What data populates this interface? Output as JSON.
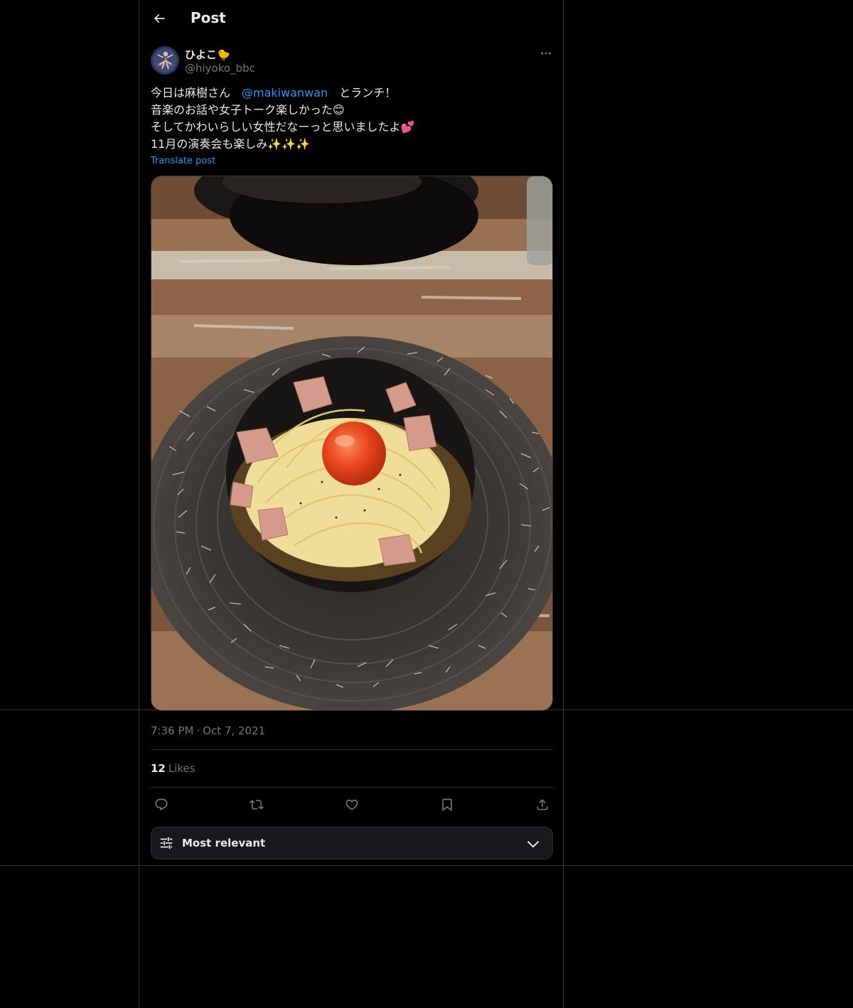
{
  "header": {
    "title": "Post"
  },
  "author": {
    "display_name": "ひよこ🐤",
    "handle": "@hiyoko_bbc"
  },
  "tweet": {
    "line1_before": "今日は麻樹さん　",
    "mention": "@makiwanwan",
    "line1_after": "　とランチ！",
    "line2": "音楽のお話や女子トーク楽しかった😊",
    "line3": "そしてかわいらしい女性だなーっと思いましたよ💕",
    "line4": "11月の演奏会も楽しみ✨✨✨",
    "translate_label": "Translate post"
  },
  "meta": {
    "time": "7:36 PM",
    "separator": "·",
    "date": "Oct 7, 2021"
  },
  "stats": {
    "likes_count": "12",
    "likes_label": "Likes"
  },
  "actions": [
    "reply-icon",
    "repost-icon",
    "like-icon",
    "bookmark-icon",
    "share-icon"
  ],
  "sort": {
    "label": "Most relevant"
  },
  "colors": {
    "background": "#000000",
    "border": "#2f3336",
    "text_primary": "#e7e9ea",
    "text_secondary": "#71767b",
    "accent": "#1d9bf0",
    "sort_bg": "#16181c"
  }
}
